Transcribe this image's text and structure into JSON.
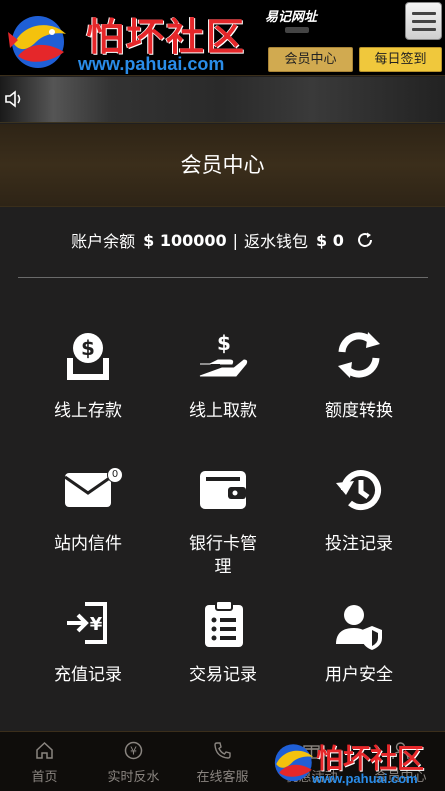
{
  "header": {
    "logo_text": "怕坏社区",
    "logo_url": "www.pahuai.com",
    "mirror_label": "易记网址",
    "member_center_button": "会员中心",
    "daily_signin_button": "每日签到"
  },
  "page": {
    "title": "会员中心"
  },
  "balance": {
    "account_label": "账户余额",
    "account_value": "$ 100000",
    "separator": "|",
    "rebate_label": "返水钱包",
    "rebate_value": "$ 0"
  },
  "grid": [
    {
      "label": "线上存款",
      "icon": "deposit-icon"
    },
    {
      "label": "线上取款",
      "icon": "withdraw-icon"
    },
    {
      "label": "额度转换",
      "icon": "transfer-icon"
    },
    {
      "label": "站内信件",
      "icon": "mail-icon",
      "badge": "0"
    },
    {
      "label": "银行卡管理",
      "icon": "wallet-icon"
    },
    {
      "label": "投注记录",
      "icon": "history-icon"
    },
    {
      "label": "充值记录",
      "icon": "recharge-record-icon"
    },
    {
      "label": "交易记录",
      "icon": "clipboard-icon"
    },
    {
      "label": "用户安全",
      "icon": "user-shield-icon"
    }
  ],
  "bottom_nav": [
    {
      "label": "首页",
      "icon": "home-icon"
    },
    {
      "label": "实时反水",
      "icon": "yen-icon"
    },
    {
      "label": "在线客服",
      "icon": "phone-icon"
    },
    {
      "label": "优惠活动",
      "icon": "gift-icon"
    },
    {
      "label": "会员中心",
      "icon": "user-icon"
    }
  ],
  "watermark": {
    "text": "怕坏社区",
    "url": "www.pahuai.com"
  },
  "colors": {
    "background": "#201f1f",
    "gold": "#d1aa50",
    "yellow": "#f0c83c",
    "logo_red": "#e5272a",
    "logo_blue": "#2a8ce8"
  }
}
